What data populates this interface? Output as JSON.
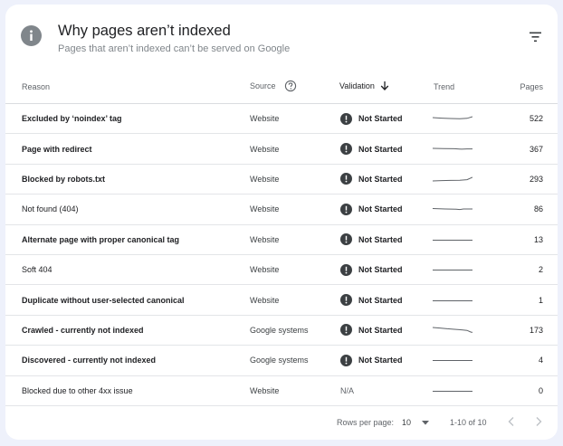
{
  "header": {
    "title": "Why pages aren’t indexed",
    "subtitle": "Pages that aren’t indexed can’t be served on Google",
    "icon": "info-icon",
    "filter_icon": "filter-icon"
  },
  "table": {
    "columns": {
      "reason": "Reason",
      "source": "Source",
      "validation": "Validation",
      "trend": "Trend",
      "pages": "Pages"
    },
    "rows": [
      {
        "reason": "Excluded by ‘noindex’ tag",
        "source": "Website",
        "validation": "Not Started",
        "pages": "522"
      },
      {
        "reason": "Page with redirect",
        "source": "Website",
        "validation": "Not Started",
        "pages": "367"
      },
      {
        "reason": "Blocked by robots.txt",
        "source": "Website",
        "validation": "Not Started",
        "pages": "293"
      },
      {
        "reason": "Not found (404)",
        "source": "Website",
        "validation": "Not Started",
        "pages": "86"
      },
      {
        "reason": "Alternate page with proper canonical tag",
        "source": "Website",
        "validation": "Not Started",
        "pages": "13"
      },
      {
        "reason": "Soft 404",
        "source": "Website",
        "validation": "Not Started",
        "pages": "2"
      },
      {
        "reason": "Duplicate without user-selected canonical",
        "source": "Website",
        "validation": "Not Started",
        "pages": "1"
      },
      {
        "reason": "Crawled - currently not indexed",
        "source": "Google systems",
        "validation": "Not Started",
        "pages": "173"
      },
      {
        "reason": "Discovered - currently not indexed",
        "source": "Google systems",
        "validation": "Not Started",
        "pages": "4"
      },
      {
        "reason": "Blocked due to other 4xx issue",
        "source": "Website",
        "validation": "N/A",
        "pages": "0"
      }
    ]
  },
  "footer": {
    "rows_per_page_label": "Rows per page:",
    "rows_per_page_value": "10",
    "range": "1-10 of 10"
  },
  "colors": {
    "background": "#eef1fb",
    "card": "#ffffff",
    "warning_icon": "#3c4043",
    "muted_text": "#5f6368"
  }
}
